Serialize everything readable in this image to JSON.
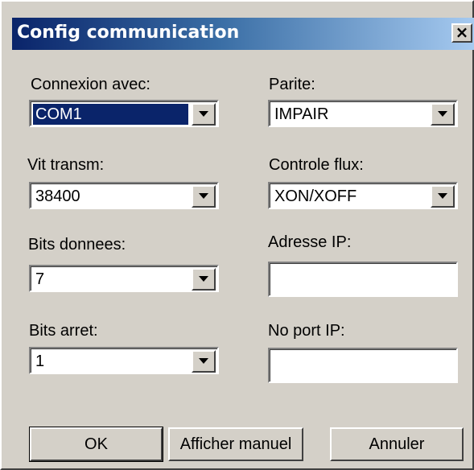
{
  "window": {
    "title": "Config communication",
    "close_glyph": "✕"
  },
  "left": {
    "connexion": {
      "label": "Connexion avec:",
      "value": "COM1"
    },
    "vitesse": {
      "label": "Vit transm:",
      "value": "38400"
    },
    "bits_donnees": {
      "label": "Bits donnees:",
      "value": "7"
    },
    "bits_arret": {
      "label": "Bits arret:",
      "value": "1"
    }
  },
  "right": {
    "parite": {
      "label": "Parite:",
      "value": "IMPAIR"
    },
    "controle_flux": {
      "label": "Controle flux:",
      "value": "XON/XOFF"
    },
    "adresse_ip": {
      "label": "Adresse IP:",
      "value": ""
    },
    "port_ip": {
      "label": "No port IP:",
      "value": ""
    }
  },
  "buttons": {
    "ok": "OK",
    "manuel": "Afficher manuel",
    "annuler": "Annuler"
  },
  "colors": {
    "titlebar_start": "#0a246a",
    "titlebar_end": "#a6caf0",
    "selection": "#0a246a",
    "face": "#d4d0c8"
  },
  "icons": {
    "close": "close-icon",
    "dropdown": "chevron-down-icon"
  }
}
